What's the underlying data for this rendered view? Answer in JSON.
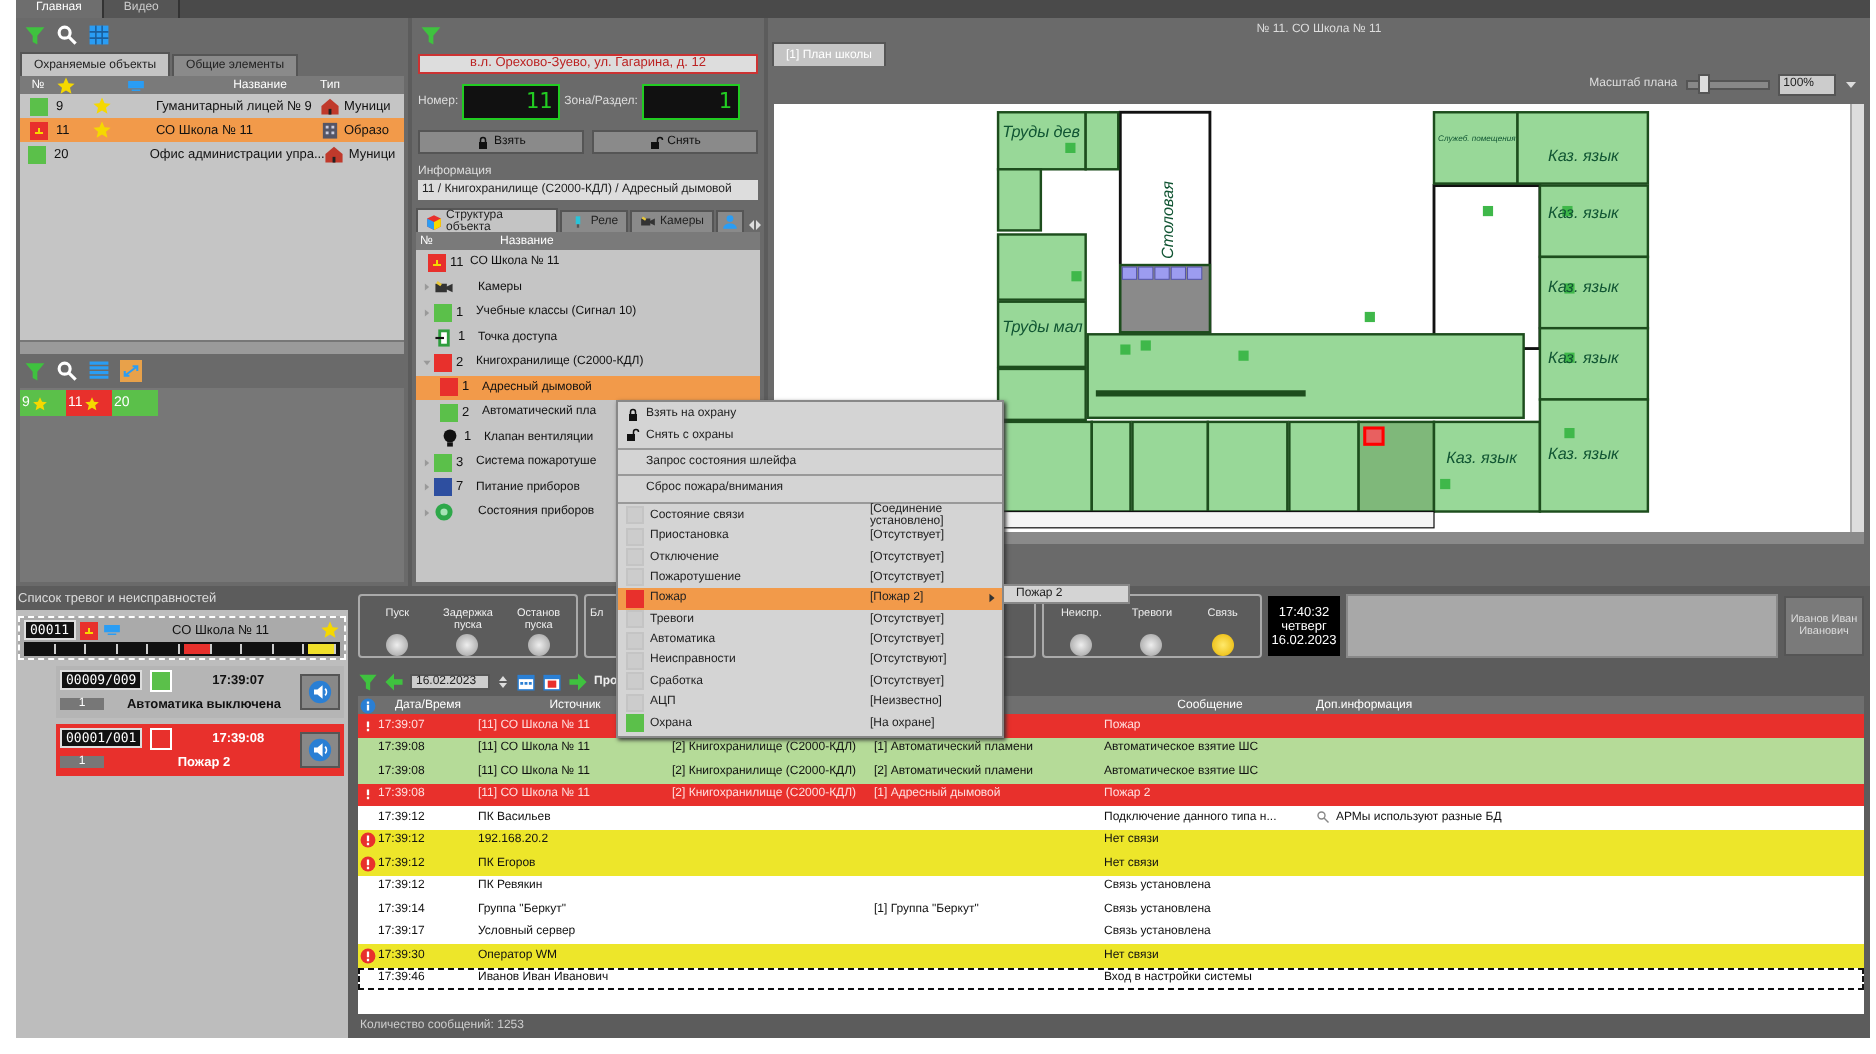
{
  "top_tabs": [
    {
      "label": "Главная",
      "selected": true
    },
    {
      "label": "Видео",
      "selected": false
    }
  ],
  "objects_panel": {
    "tabs": [
      {
        "label": "Охраняемые объекты",
        "selected": true
      },
      {
        "label": "Общие элементы",
        "selected": false
      }
    ],
    "columns": [
      "№",
      "Название",
      "Тип"
    ],
    "rows": [
      {
        "number": "9",
        "color": "#5bc04a",
        "starred": true,
        "name": "Гуманитарный лицей № 9",
        "type": "Муници",
        "selected": false
      },
      {
        "number": "11",
        "color": "#e8302c",
        "starred": true,
        "name": "СО Школа № 11",
        "type": "Образо",
        "selected": true
      },
      {
        "number": "20",
        "color": "#5bc04a",
        "starred": false,
        "name": "Офис администрации упра...",
        "type": "Муници",
        "selected": false
      }
    ]
  },
  "tiles": [
    {
      "number": "9",
      "color": "#5bc04a",
      "starred": true
    },
    {
      "number": "11",
      "color": "#e8302c",
      "starred": true
    },
    {
      "number": "20",
      "color": "#5bc04a",
      "starred": false
    }
  ],
  "object_card": {
    "address": "в.л. Орехово-Зуево, ул. Гагарина, д. 12",
    "number_label": "Номер:",
    "number_value": "11",
    "zone_label": "Зона/Раздел:",
    "zone_value": "1",
    "buttons": [
      {
        "kind": "arm",
        "label": "Взять"
      },
      {
        "kind": "disarm",
        "label": "Снять"
      }
    ],
    "info_label": "Информация",
    "info_value": "11 / Книгохранилище (С2000-КДЛ) / Адресный дымовой",
    "tabs": [
      {
        "kind": "structure",
        "label": "Структура объекта",
        "selected": true
      },
      {
        "kind": "relay",
        "label": "Реле",
        "selected": false
      },
      {
        "kind": "cameras",
        "label": "Камеры",
        "selected": false
      }
    ],
    "tree_columns": [
      "№",
      "Название"
    ],
    "tree": [
      {
        "kind": "object",
        "color": "#e8302c",
        "number": "11",
        "name": "СО Школа № 11",
        "selected": false,
        "children": [
          {
            "kind": "cameras",
            "name": "Камеры",
            "expanded": false,
            "selected": false
          },
          {
            "kind": "zone",
            "color": "#5bc04a",
            "number": "1",
            "name": "Учебные классы (Сигнал 10)",
            "expanded": false,
            "selected": false
          },
          {
            "kind": "door",
            "number": "1",
            "name": "Точка доступа",
            "selected": false
          },
          {
            "kind": "zone",
            "color": "#e8302c",
            "number": "2",
            "name": "Книгохранилище (С2000-КДЛ)",
            "expanded": true,
            "selected": false,
            "children": [
              {
                "kind": "zone",
                "color": "#e8302c",
                "number": "1",
                "name": "Адресный дымовой",
                "selected": true
              },
              {
                "kind": "zone",
                "color": "#5bc04a",
                "number": "2",
                "name": "Автоматический пла",
                "selected": false
              },
              {
                "kind": "valve",
                "number": "1",
                "name": "Клапан вентиляции",
                "selected": false
              }
            ]
          },
          {
            "kind": "zone",
            "color": "#5bc04a",
            "number": "3",
            "name": "Система пожаротуше",
            "expanded": false,
            "selected": false
          },
          {
            "kind": "zone",
            "color": "#2e4fa0",
            "number": "7",
            "name": "Питание приборов",
            "expanded": false,
            "selected": false
          },
          {
            "kind": "devices",
            "name": "Состояния приборов",
            "expanded": false,
            "selected": false
          }
        ]
      }
    ]
  },
  "plan": {
    "title": "№ 11. СО Школа № 11",
    "tab": "[1] План школы",
    "scale_label": "Масштаб плана",
    "scale_slider": {
      "level": 0.15
    },
    "scale_value": "100%",
    "rooms": [
      "Труды дев",
      "Столовая",
      "Труды мал",
      "Служеб. помещения",
      "Каз. язык",
      "Каз. язык",
      "Каз. язык",
      "Каз. язык",
      "Каз. язык",
      "Каз. язык"
    ]
  },
  "alarm_panel": {
    "title": "Список тревог и неисправностей",
    "object_number": "00011",
    "object_name": "СО Школа № 11",
    "segments": [
      {
        "color": "#111111"
      },
      {
        "color": "#111111"
      },
      {
        "color": "#111111"
      },
      {
        "color": "#111111"
      },
      {
        "color": "#111111"
      },
      {
        "color": "#e8302c"
      },
      {
        "color": "#111111"
      },
      {
        "color": "#111111"
      },
      {
        "color": "#111111"
      },
      {
        "color": "#f0e02a"
      }
    ],
    "alarms": [
      {
        "counter": "00009/009",
        "color": "#5bc04a",
        "time": "17:39:07",
        "zone": "1",
        "message": "Автоматика выключена",
        "active": false
      },
      {
        "counter": "00001/001",
        "color": "#e8302c",
        "time": "17:39:08",
        "zone": "1",
        "message": "Пожар 2",
        "active": true
      }
    ]
  },
  "control_groups": [
    {
      "lamps": [
        {
          "label": "Пуск",
          "on": false
        },
        {
          "label": "Задержка пуска",
          "on": false
        },
        {
          "label": "Останов пуска",
          "on": false
        }
      ]
    },
    {
      "lamps": [
        {
          "label": "Бл"
        }
      ]
    },
    {
      "lamps": [
        {
          "label": "Неиспр.",
          "on": false
        },
        {
          "label": "Тревоги",
          "on": false
        },
        {
          "label": "Связь",
          "on": true
        }
      ]
    }
  ],
  "clock": {
    "time": "17:40:32",
    "weekday": "четверг",
    "date": "16.02.2023"
  },
  "user": "Иванов Иван Иванович",
  "events_toolbar": {
    "date": "16.02.2023",
    "cut_label": "Про"
  },
  "events": {
    "columns": [
      "Дата/Время",
      "Источник",
      "Сообщение",
      "Доп.информация"
    ],
    "rows": [
      {
        "kind": "fire",
        "time": "17:39:07",
        "source": "[11] СО Школа № 11",
        "message": "Пожар",
        "selected": false
      },
      {
        "kind": "auto",
        "time": "17:39:08",
        "source": "[11] СО Школа № 11",
        "zone": "[2] Книгохранилище (С2000-КДЛ)",
        "sensor": "[1] Автоматический пламени",
        "message": "Автоматическое взятие ШС",
        "selected": false
      },
      {
        "kind": "auto",
        "time": "17:39:08",
        "source": "[11] СО Школа № 11",
        "zone": "[2] Книгохранилище (С2000-КДЛ)",
        "sensor": "[2] Автоматический пламени",
        "message": "Автоматическое взятие ШС",
        "selected": false
      },
      {
        "kind": "fire",
        "time": "17:39:08",
        "source": "[11] СО Школа № 11",
        "zone": "[2] Книгохранилище (С2000-КДЛ)",
        "sensor": "[1] Адресный дымовой",
        "message": "Пожар 2",
        "selected": false
      },
      {
        "kind": "info",
        "time": "17:39:12",
        "source": "ПК Васильев",
        "message": "Подключение данного типа н...",
        "extra": "АРМы используют разные БД",
        "selected": false
      },
      {
        "kind": "fault",
        "time": "17:39:12",
        "source": "192.168.20.2",
        "message": "Нет связи",
        "selected": false
      },
      {
        "kind": "fault",
        "time": "17:39:12",
        "source": "ПК Егоров",
        "message": "Нет связи",
        "selected": false
      },
      {
        "kind": "info",
        "time": "17:39:12",
        "source": "ПК Ревякин",
        "message": "Связь установлена",
        "selected": false
      },
      {
        "kind": "info",
        "time": "17:39:14",
        "source": "Группа \"Беркут\"",
        "sensor": "[1] Группа \"Беркут\"",
        "message": "Связь установлена",
        "selected": false
      },
      {
        "kind": "info",
        "time": "17:39:17",
        "source": "Условный сервер",
        "message": "Связь установлена",
        "selected": false
      },
      {
        "kind": "fault",
        "time": "17:39:30",
        "source": "Оператор WM",
        "message": "Нет связи",
        "selected": false
      },
      {
        "kind": "info",
        "time": "17:39:46",
        "source": "Иванов Иван Иванович",
        "message": "Вход в настройки системы",
        "selected": true
      }
    ],
    "count": "Количество сообщений: 1253"
  },
  "context_menu": {
    "items": [
      {
        "kind": "arm",
        "label": "Взять на охрану"
      },
      {
        "kind": "disarm",
        "label": "Снять с охраны"
      },
      {
        "kind": "command",
        "label": "Запрос состояния шлейфа"
      },
      {
        "kind": "command",
        "label": "Сброс пожара/внимания"
      },
      {
        "kind": "state",
        "label": "Состояние связи",
        "value": "[Соединение установлено]",
        "selected": false
      },
      {
        "kind": "state",
        "label": "Приостановка",
        "value": "[Отсутствует]",
        "selected": false
      },
      {
        "kind": "state",
        "label": "Отключение",
        "value": "[Отсутствует]",
        "selected": false
      },
      {
        "kind": "state",
        "label": "Пожаротушение",
        "value": "[Отсутствует]",
        "selected": false
      },
      {
        "kind": "state",
        "label": "Пожар",
        "value": "[Пожар 2]",
        "color": "#e8302c",
        "selected": true,
        "submenu": [
          "Пожар 2"
        ]
      },
      {
        "kind": "state",
        "label": "Тревоги",
        "value": "[Отсутствует]",
        "selected": false
      },
      {
        "kind": "state",
        "label": "Автоматика",
        "value": "[Отсутствует]",
        "selected": false
      },
      {
        "kind": "state",
        "label": "Неисправности",
        "value": "[Отсутствуют]",
        "selected": false
      },
      {
        "kind": "state",
        "label": "Сработка",
        "value": "[Отсутствует]",
        "selected": false
      },
      {
        "kind": "state",
        "label": "АЦП",
        "value": "[Неизвестно]",
        "selected": false
      },
      {
        "kind": "state",
        "label": "Охрана",
        "value": "[На охране]",
        "color": "#5bc04a",
        "selected": false
      }
    ]
  }
}
